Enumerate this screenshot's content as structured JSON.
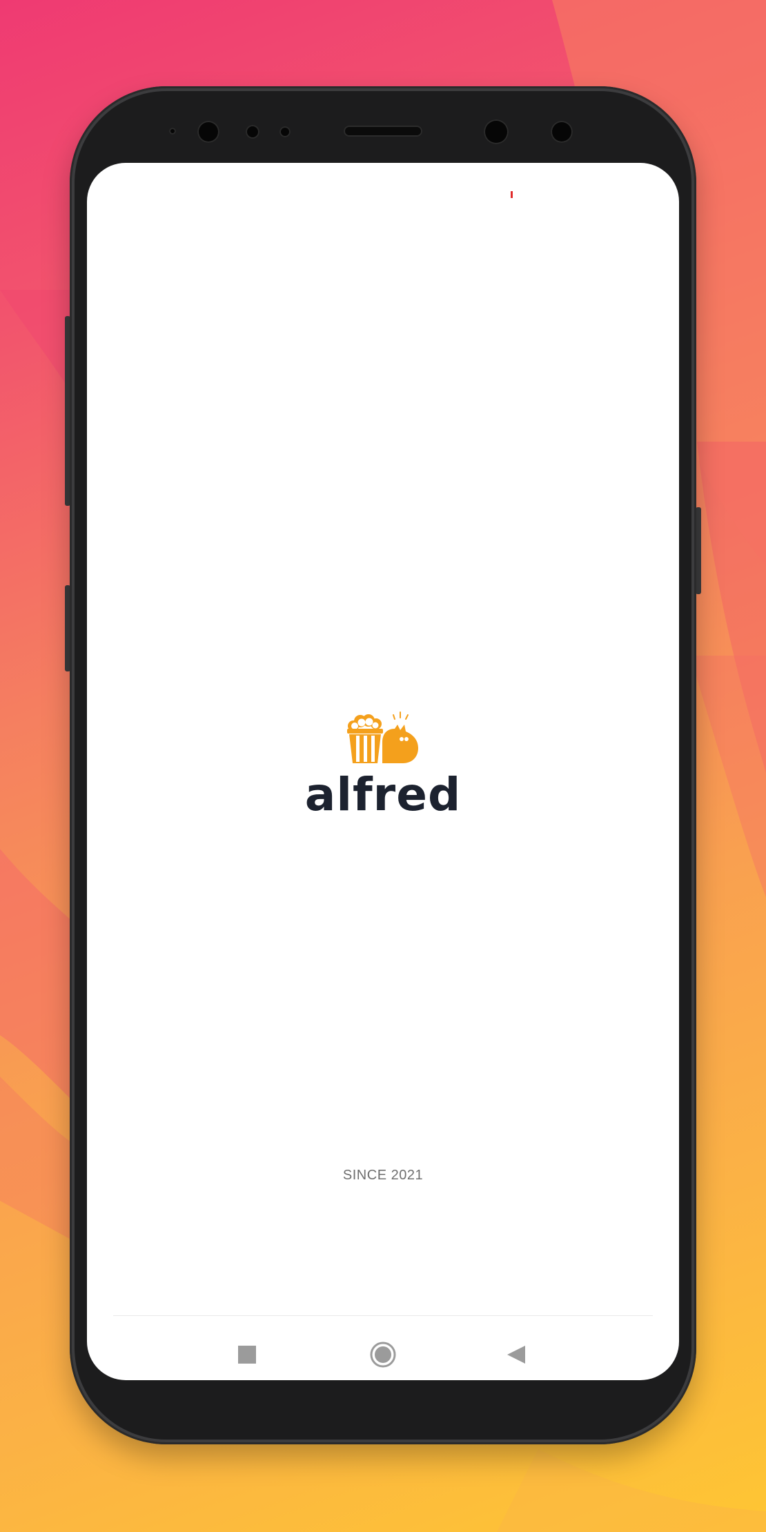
{
  "app": {
    "brand_name": "alfred",
    "tagline": "SINCE 2021",
    "logo_icon": "popcorn-cat-logo-icon"
  },
  "colors": {
    "logo_orange": "#f4a01c",
    "brand_text": "#1c222f",
    "screen_bg": "#ffffff",
    "status_indicator": "#e02b2b"
  },
  "navigation_bar": {
    "items": [
      {
        "name": "recents",
        "icon": "square-icon"
      },
      {
        "name": "home",
        "icon": "circle-icon"
      },
      {
        "name": "back",
        "icon": "triangle-back-icon"
      }
    ]
  }
}
